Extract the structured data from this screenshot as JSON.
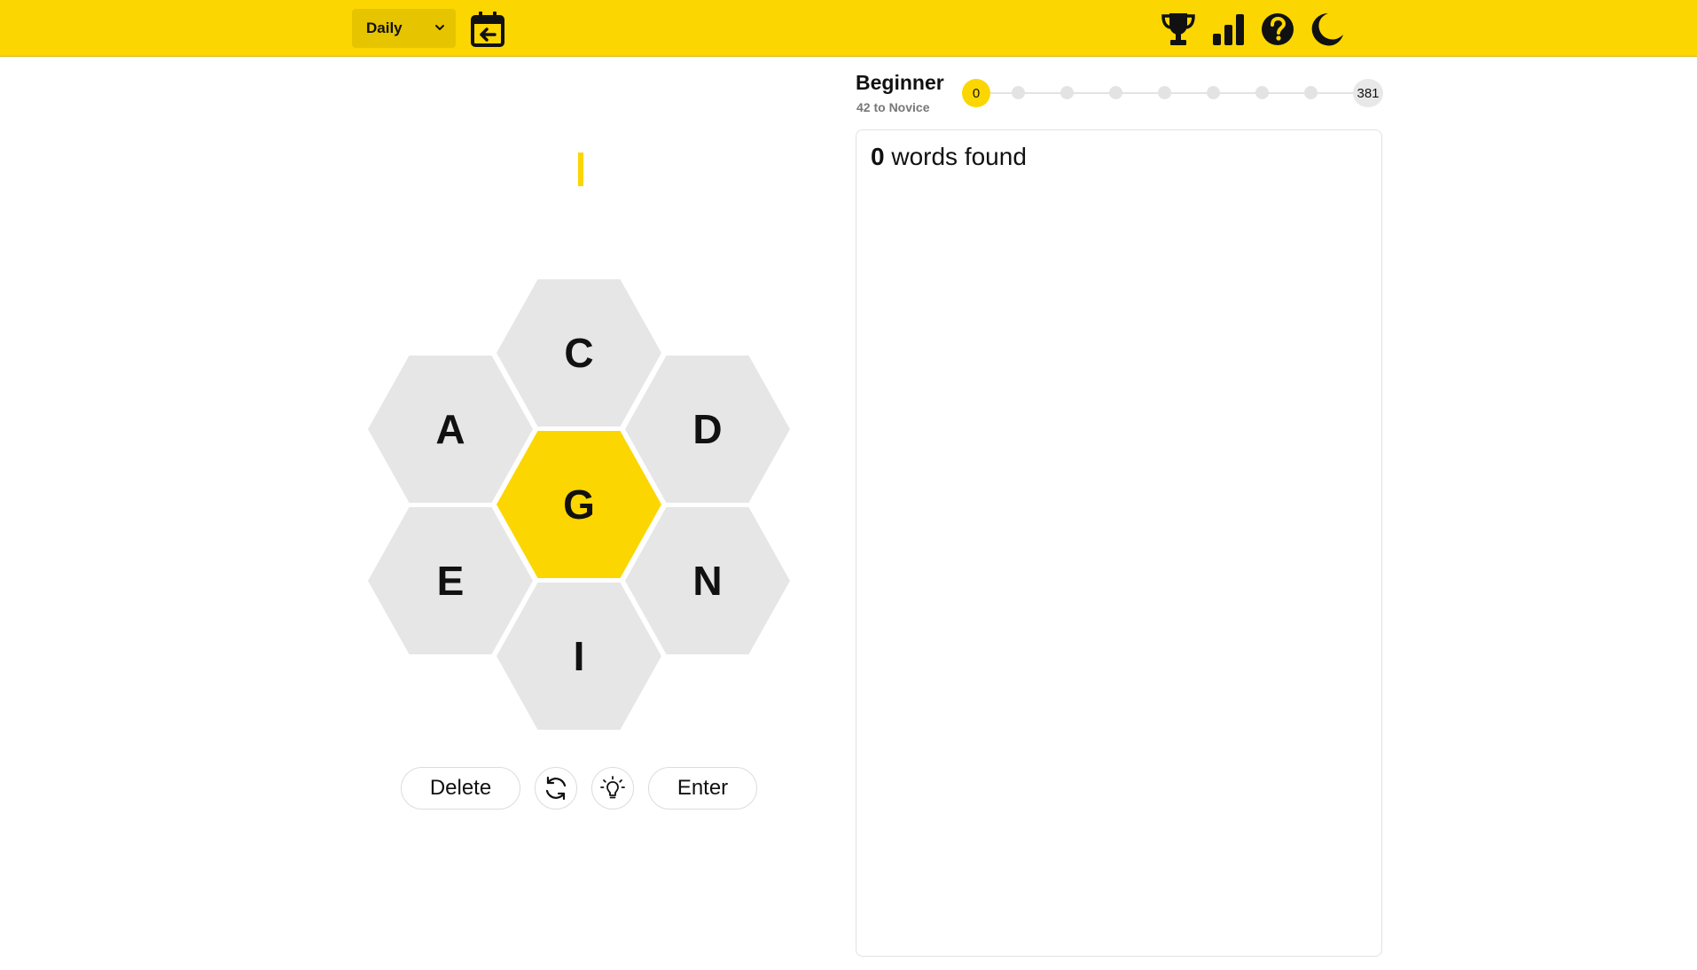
{
  "header": {
    "mode_select": {
      "value": "Daily",
      "icon": "chevron-down-icon"
    },
    "icons": [
      "calendar-back-icon",
      "trophy-icon",
      "stats-icon",
      "help-icon",
      "moon-icon"
    ]
  },
  "colors": {
    "accent": "#fcd600",
    "cell_outer": "#e6e6e6",
    "cell_center": "#fcd600"
  },
  "hive": {
    "center_letter": "G",
    "outer_letters": {
      "top": "C",
      "upper_left": "A",
      "upper_right": "D",
      "lower_left": "E",
      "lower_right": "N",
      "bottom": "I"
    }
  },
  "controls": {
    "delete_label": "Delete",
    "shuffle_icon": "shuffle-icon",
    "hint_icon": "lightbulb-icon",
    "enter_label": "Enter"
  },
  "rank": {
    "name": "Beginner",
    "subtitle": "42 to Novice",
    "current_score": "0",
    "max_score": "381"
  },
  "words": {
    "count": "0",
    "label": "words found"
  }
}
